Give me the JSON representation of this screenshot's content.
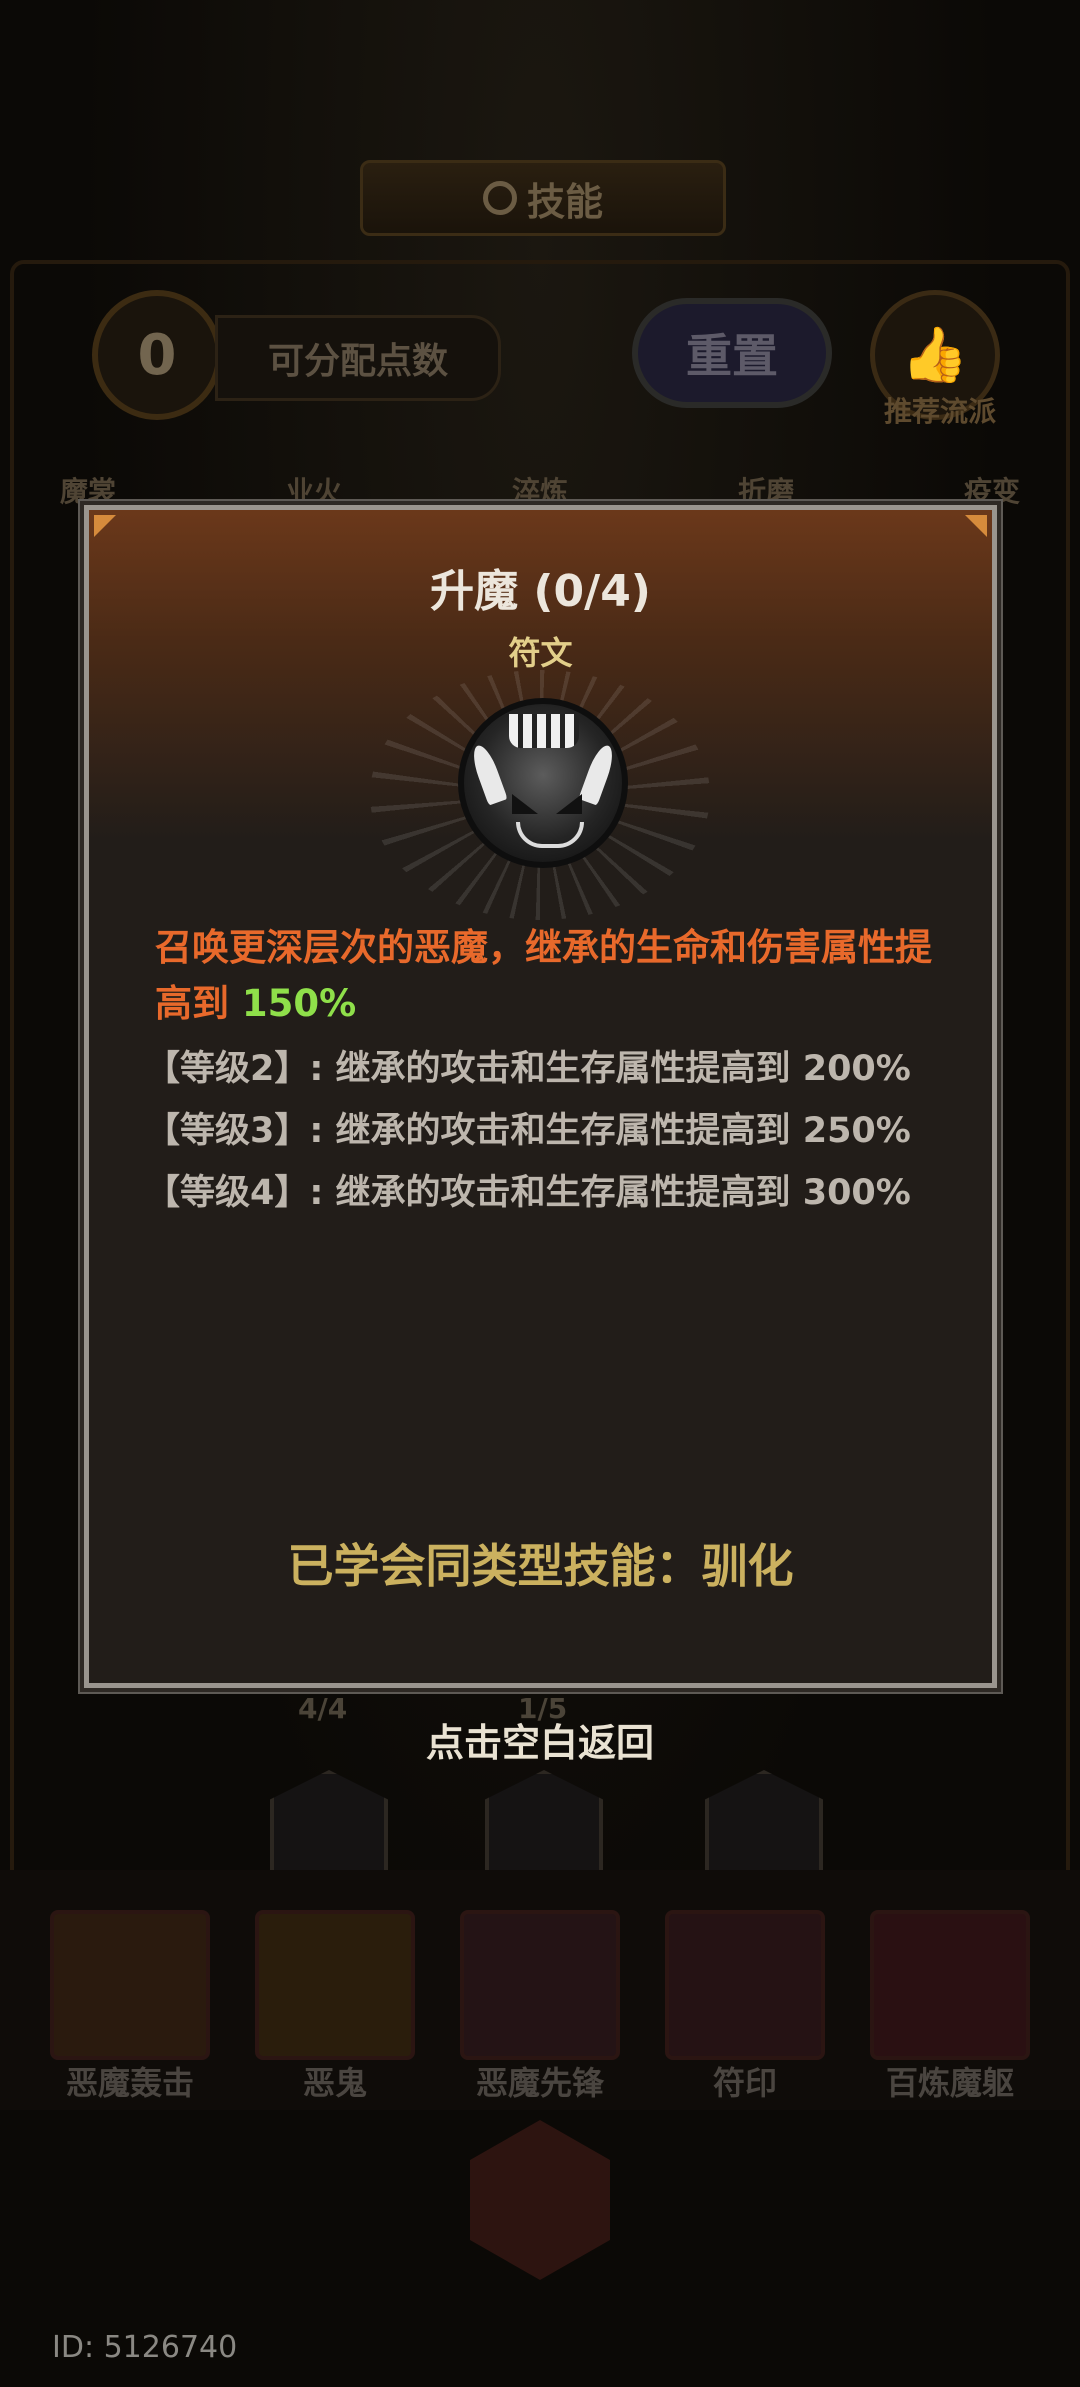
{
  "background": {
    "title": "技能",
    "skill_points": "0",
    "skill_points_label": "可分配点数",
    "reset_label": "重置",
    "recommend_label": "推荐流派",
    "tabs": [
      "魔裳",
      "业火",
      "淬炼",
      "折磨",
      "疫变"
    ],
    "tree_progress": [
      "4/4",
      "1/5"
    ],
    "skills": [
      "恶魔轰击",
      "恶鬼",
      "恶魔先锋",
      "符印",
      "百炼魔躯"
    ]
  },
  "popup": {
    "title": "升魔 (0/4)",
    "subtitle": "符文",
    "icon": "demon-face-icon",
    "description_main": "召唤更深层次的恶魔，继承的生命和伤害属性提高到 ",
    "description_value": "150%",
    "levels": [
      "【等级2】: 继承的攻击和生存属性提高到 200%",
      "【等级3】: 继承的攻击和生存属性提高到 250%",
      "【等级4】: 继承的攻击和生存属性提高到 300%"
    ],
    "learned": "已学会同类型技能：驯化"
  },
  "return_hint": "点击空白返回",
  "user_id": "ID: 5126740",
  "colors": {
    "description": "#e8692b",
    "highlight": "#8fdf4a",
    "learned": "#cbb15f",
    "subtitle": "#e3cf8a"
  }
}
